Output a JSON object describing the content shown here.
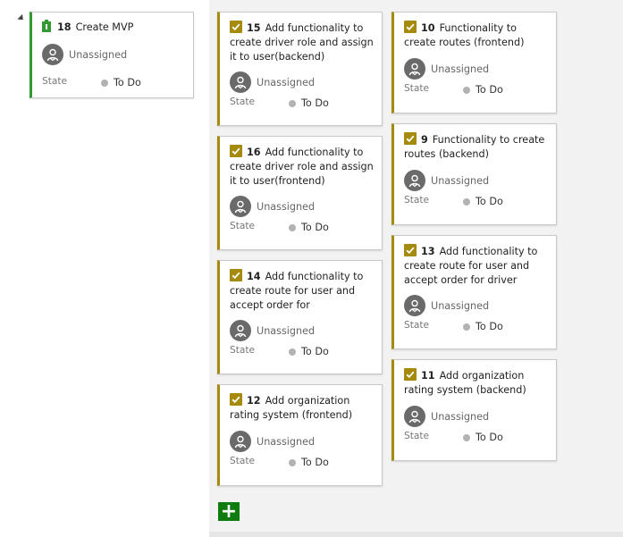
{
  "parent": {
    "id": "18",
    "title": "Create MVP",
    "assignee": "Unassigned",
    "state_label": "State",
    "state_value": "To Do",
    "color": "#339933"
  },
  "task_color": "#a58a0e",
  "columns": [
    [
      {
        "id": "15",
        "title": "Add functionality to create driver role and assign it to user(backend)",
        "assignee": "Unassigned",
        "state_label": "State",
        "state_value": "To Do"
      },
      {
        "id": "16",
        "title": "Add functionality to create driver role and assign it to user(frontend)",
        "assignee": "Unassigned",
        "state_label": "State",
        "state_value": "To Do"
      },
      {
        "id": "14",
        "title": "Add functionality to create route for user and accept order for",
        "assignee": "Unassigned",
        "state_label": "State",
        "state_value": "To Do"
      },
      {
        "id": "12",
        "title": "Add organization rating system (frontend)",
        "assignee": "Unassigned",
        "state_label": "State",
        "state_value": "To Do"
      }
    ],
    [
      {
        "id": "10",
        "title": "Functionality to create routes (frontend)",
        "assignee": "Unassigned",
        "state_label": "State",
        "state_value": "To Do"
      },
      {
        "id": "9",
        "title": "Functionality to create routes (backend)",
        "assignee": "Unassigned",
        "state_label": "State",
        "state_value": "To Do"
      },
      {
        "id": "13",
        "title": "Add functionality to create route for user and accept order for driver",
        "assignee": "Unassigned",
        "state_label": "State",
        "state_value": "To Do"
      },
      {
        "id": "11",
        "title": "Add organization rating system (backend)",
        "assignee": "Unassigned",
        "state_label": "State",
        "state_value": "To Do"
      }
    ]
  ],
  "add_button": {
    "label": "+"
  },
  "icons": {
    "collapse": "collapse-arrow-icon",
    "epic": "trophy-icon",
    "task": "task-check-icon",
    "avatar": "unassigned-avatar-icon"
  }
}
